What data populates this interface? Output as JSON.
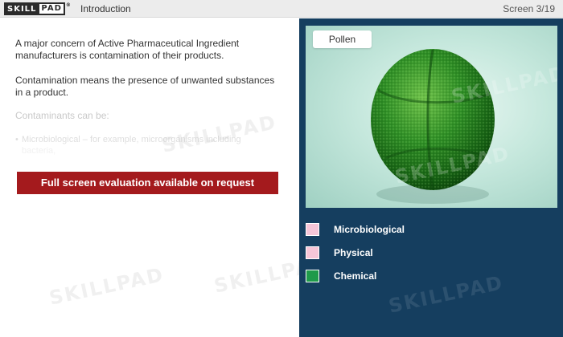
{
  "header": {
    "logo_left": "SKILL",
    "logo_right": "PAD",
    "logo_mark": "®",
    "section_title": "Introduction",
    "screen_counter": "Screen 3/19"
  },
  "content": {
    "paragraph1": "A major concern of Active Pharmaceutical Ingredient manufacturers is contamination of their products.",
    "paragraph2": "Contamination means the presence of unwanted substances in a product.",
    "paragraph3": "Contaminants can be:",
    "bullet_marker": "•",
    "bullet1_text": "Microbiological – for example, microorganisms including",
    "bullet1_cut": "bacteria,",
    "eval_banner": "Full screen evaluation available on request"
  },
  "image_panel": {
    "label": "Pollen",
    "icon": "pollen-image"
  },
  "options": [
    {
      "label": "Microbiological",
      "color": "#f6c6d8"
    },
    {
      "label": "Physical",
      "color": "#f6c6d8"
    },
    {
      "label": "Chemical",
      "color": "#1e9a4a"
    }
  ],
  "watermark": "SKILLPAD"
}
